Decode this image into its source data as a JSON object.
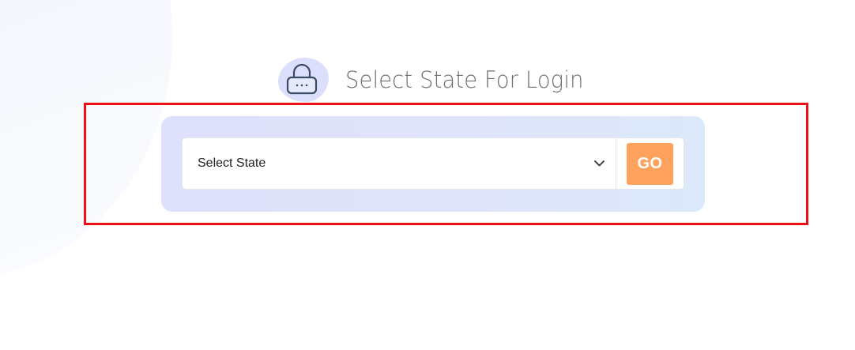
{
  "heading": {
    "title": "Select State For Login",
    "icon": "lock-icon"
  },
  "state_form": {
    "select": {
      "selected_value": "Select State",
      "icon": "chevron-down-icon"
    },
    "go_button_label": "GO"
  },
  "colors": {
    "accent": "#ffa25e",
    "highlight_border": "#ee0f17",
    "card_background": "#dfe0fb",
    "lock_blob": "#dcdffb",
    "heading_text": "#6e6e72"
  }
}
